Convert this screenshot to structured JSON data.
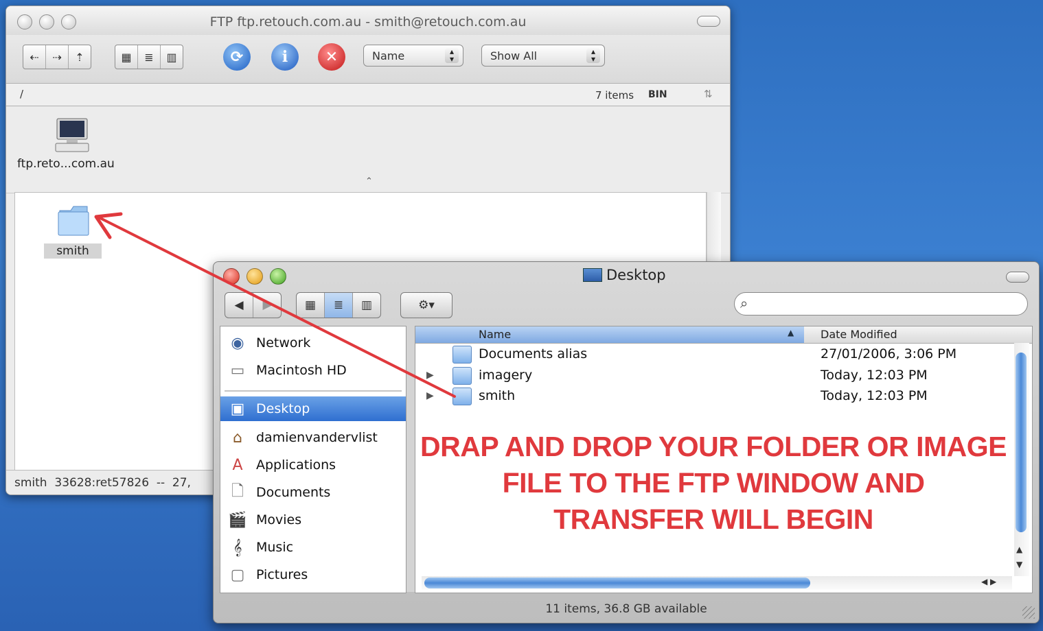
{
  "ftp_window": {
    "title": "FTP ftp.retouch.com.au - smith@retouch.com.au",
    "toolbar": {
      "nav_buttons": [
        "⇠",
        "⇢",
        "⇡"
      ],
      "view_buttons": [
        "▦",
        "≣",
        "▥"
      ],
      "sort_popup": "Name",
      "filter_popup": "Show All"
    },
    "path_bar": {
      "path": "/",
      "item_count": "7 items",
      "mode": "BIN"
    },
    "server": {
      "label": "ftp.retо...com.au"
    },
    "folder": {
      "label": "smith"
    },
    "status": "smith  33628:ret57826  --  27,"
  },
  "finder_window": {
    "title": "Desktop",
    "search": {
      "placeholder": ""
    },
    "sidebar": {
      "devices": [
        {
          "label": "Network",
          "icon": "network-icon"
        },
        {
          "label": "Macintosh HD",
          "icon": "hard-drive-icon"
        }
      ],
      "places": [
        {
          "label": "Desktop",
          "icon": "desktop-icon",
          "selected": true
        },
        {
          "label": "damienvandervlist",
          "icon": "home-icon"
        },
        {
          "label": "Applications",
          "icon": "applications-icon"
        },
        {
          "label": "Documents",
          "icon": "documents-icon"
        },
        {
          "label": "Movies",
          "icon": "movies-icon"
        },
        {
          "label": "Music",
          "icon": "music-icon"
        },
        {
          "label": "Pictures",
          "icon": "pictures-icon"
        }
      ]
    },
    "columns": {
      "name": "Name",
      "date": "Date Modified"
    },
    "rows": [
      {
        "name": "Documents alias",
        "date": "27/01/2006, 3:06 PM",
        "expandable": false
      },
      {
        "name": "imagery",
        "date": "Today, 12:03 PM",
        "expandable": true
      },
      {
        "name": "smith",
        "date": "Today, 12:03 PM",
        "expandable": true
      }
    ],
    "overlay_message": [
      "DRAP AND DROP YOUR FOLDER OR IMAGE",
      "FILE TO THE FTP WINDOW AND",
      "TRANSFER WILL BEGIN"
    ],
    "status": "11 items, 36.8 GB available"
  },
  "colors": {
    "arrow": "#e0393d",
    "selection": "#2f6fd0",
    "desktop": "#3b7fd0"
  }
}
